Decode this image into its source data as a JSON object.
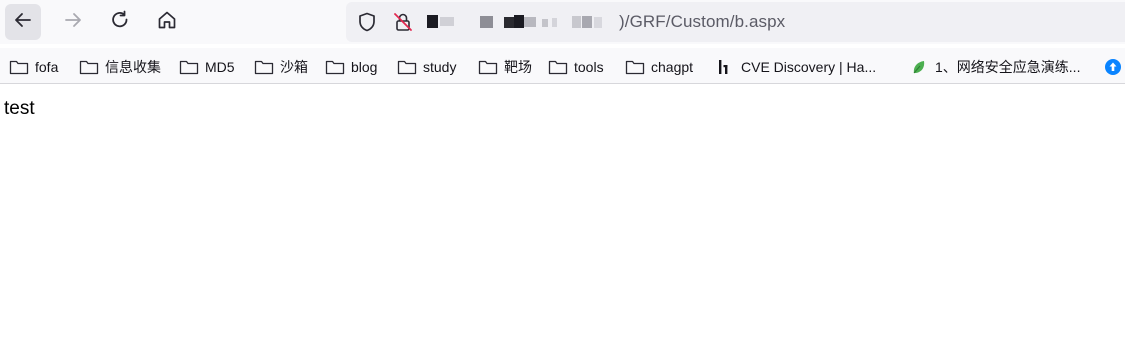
{
  "navigation": {
    "back_icon": "arrow-left-icon",
    "forward_icon": "arrow-right-icon",
    "reload_icon": "reload-icon",
    "home_icon": "home-icon"
  },
  "urlbar": {
    "shield_icon": "tracking-shield-icon",
    "lock_icon": "insecure-lock-icon",
    "visible_url_path": ")/GRF/Custom/b.aspx"
  },
  "bookmarks": [
    {
      "label": "fofa",
      "icon": "folder-icon"
    },
    {
      "label": "信息收集",
      "icon": "folder-icon"
    },
    {
      "label": "MD5",
      "icon": "folder-icon"
    },
    {
      "label": "沙箱",
      "icon": "folder-icon"
    },
    {
      "label": "blog",
      "icon": "folder-icon"
    },
    {
      "label": "study",
      "icon": "folder-icon"
    },
    {
      "label": "靶场",
      "icon": "folder-icon"
    },
    {
      "label": "tools",
      "icon": "folder-icon"
    },
    {
      "label": "chagpt",
      "icon": "folder-icon"
    },
    {
      "label": "CVE Discovery | Ha...",
      "icon": "h1-favicon-icon"
    },
    {
      "label": "1、网络安全应急演练...",
      "icon": "leaf-favicon-icon"
    }
  ],
  "bookmark_overflow_icon": "blue-circle-favicon-icon",
  "page": {
    "body_text": "test"
  },
  "colors": {
    "toolbar_bg": "#f9f9fb",
    "urlbar_bg": "#f0f0f4",
    "active_button_bg": "#e3e3e8",
    "accent_blue": "#0a84ff",
    "leaf_green": "#4caf50"
  }
}
